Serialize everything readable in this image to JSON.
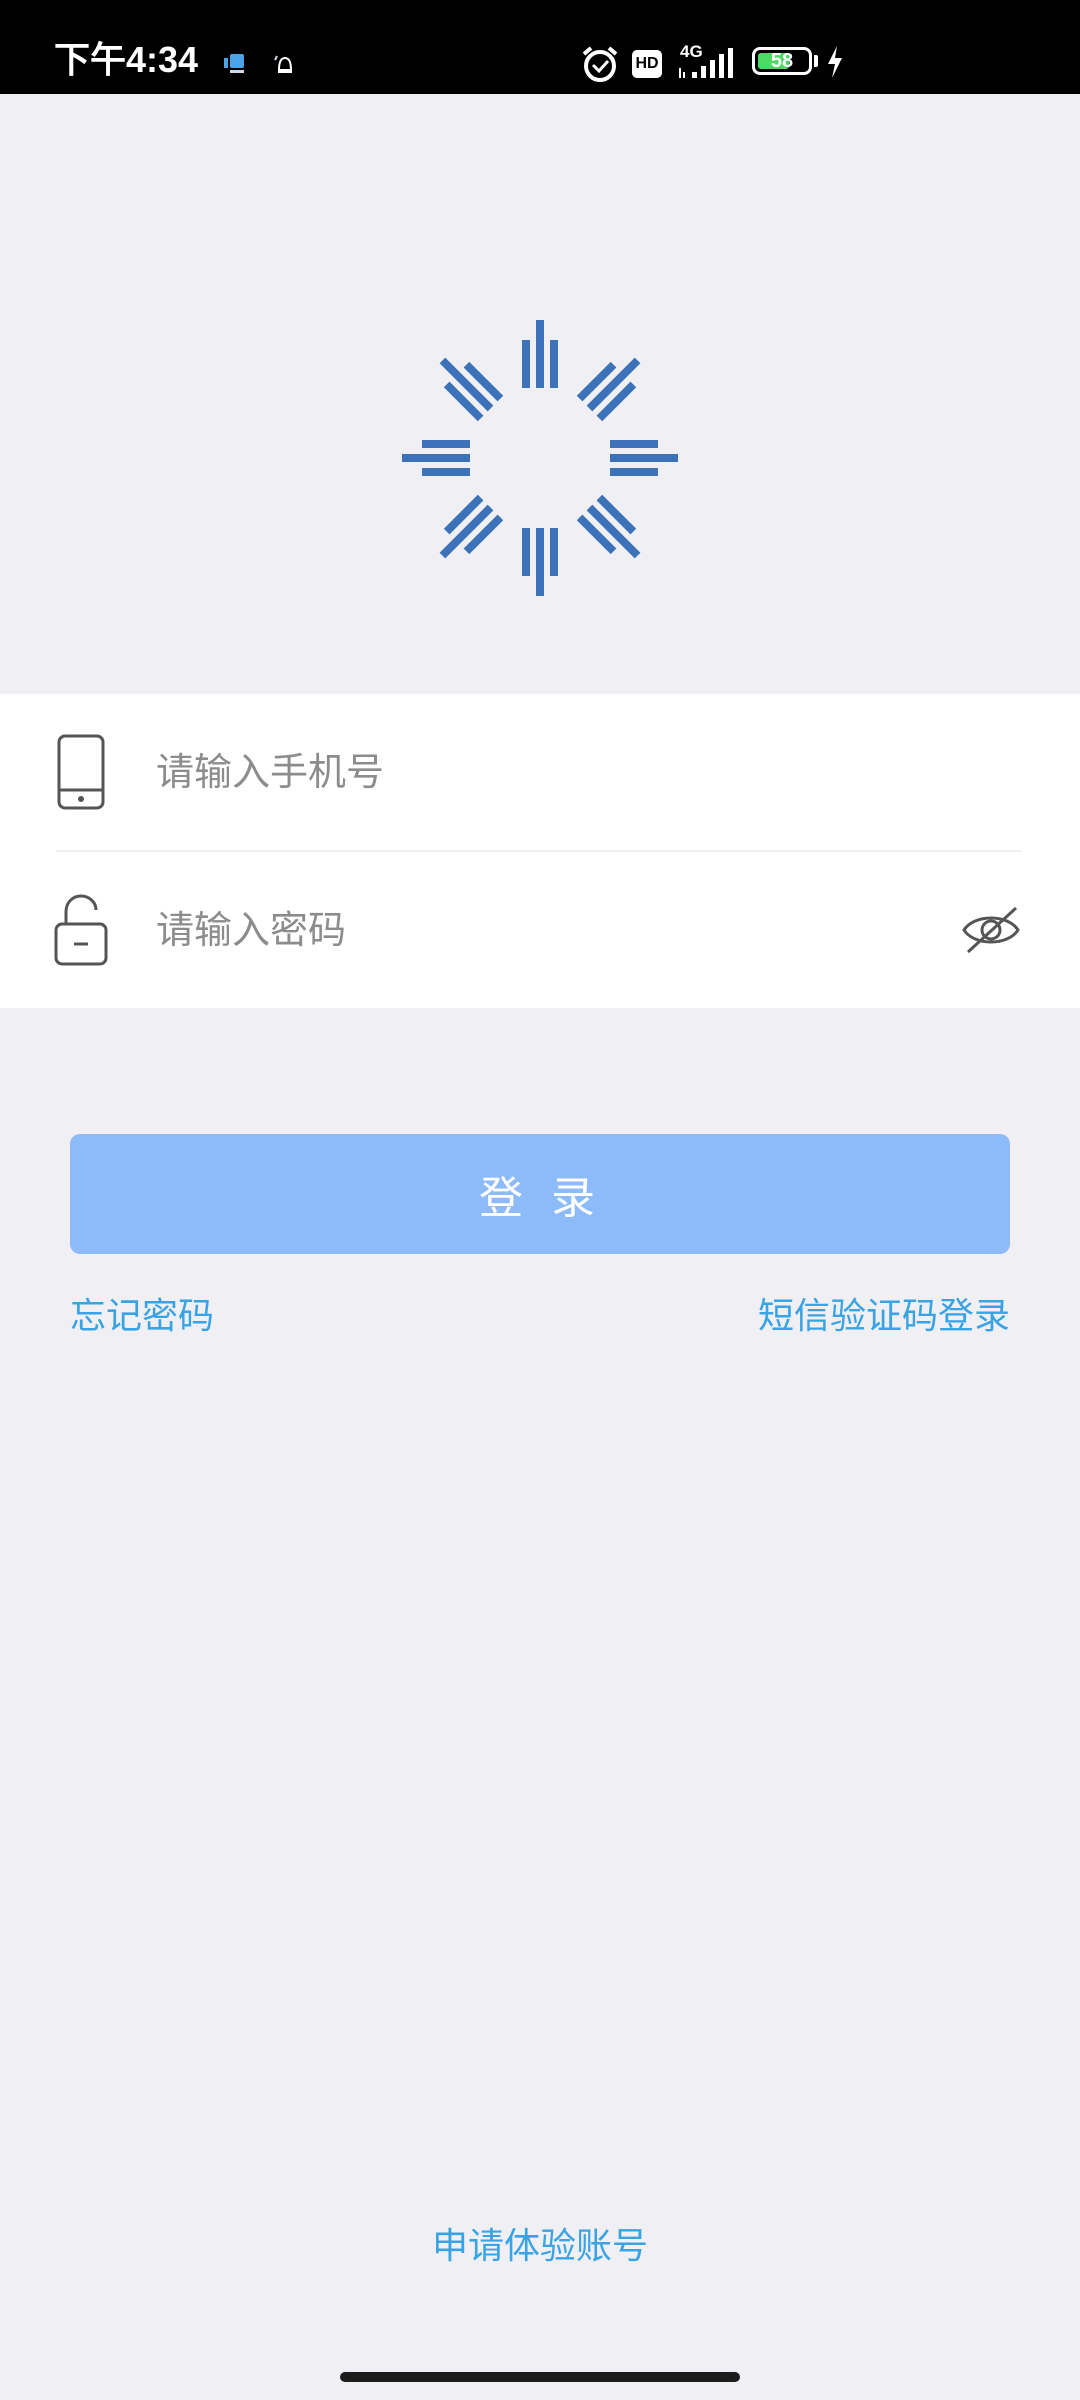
{
  "status_bar": {
    "time": "下午4:34",
    "network": "4G",
    "hd": "HD",
    "battery": "58",
    "icons": [
      "app-notification-icon",
      "notification-icon",
      "alarm-icon",
      "hd-icon",
      "signal-icon",
      "battery-icon",
      "charging-icon"
    ]
  },
  "logo": {
    "icon": "sun-logo-icon",
    "color": "#3b72b9"
  },
  "login": {
    "phone_placeholder": "请输入手机号",
    "password_placeholder": "请输入密码",
    "phone_icon": "phone-icon",
    "lock_icon": "lock-icon",
    "eye_icon": "eye-off-icon",
    "submit_label": "登录",
    "forgot_password": "忘记密码",
    "sms_login": "短信验证码登录"
  },
  "footer": {
    "apply_trial": "申请体验账号"
  },
  "colors": {
    "background": "#efeff4",
    "button": "#8dbaf8",
    "link": "#3aa3e3"
  }
}
